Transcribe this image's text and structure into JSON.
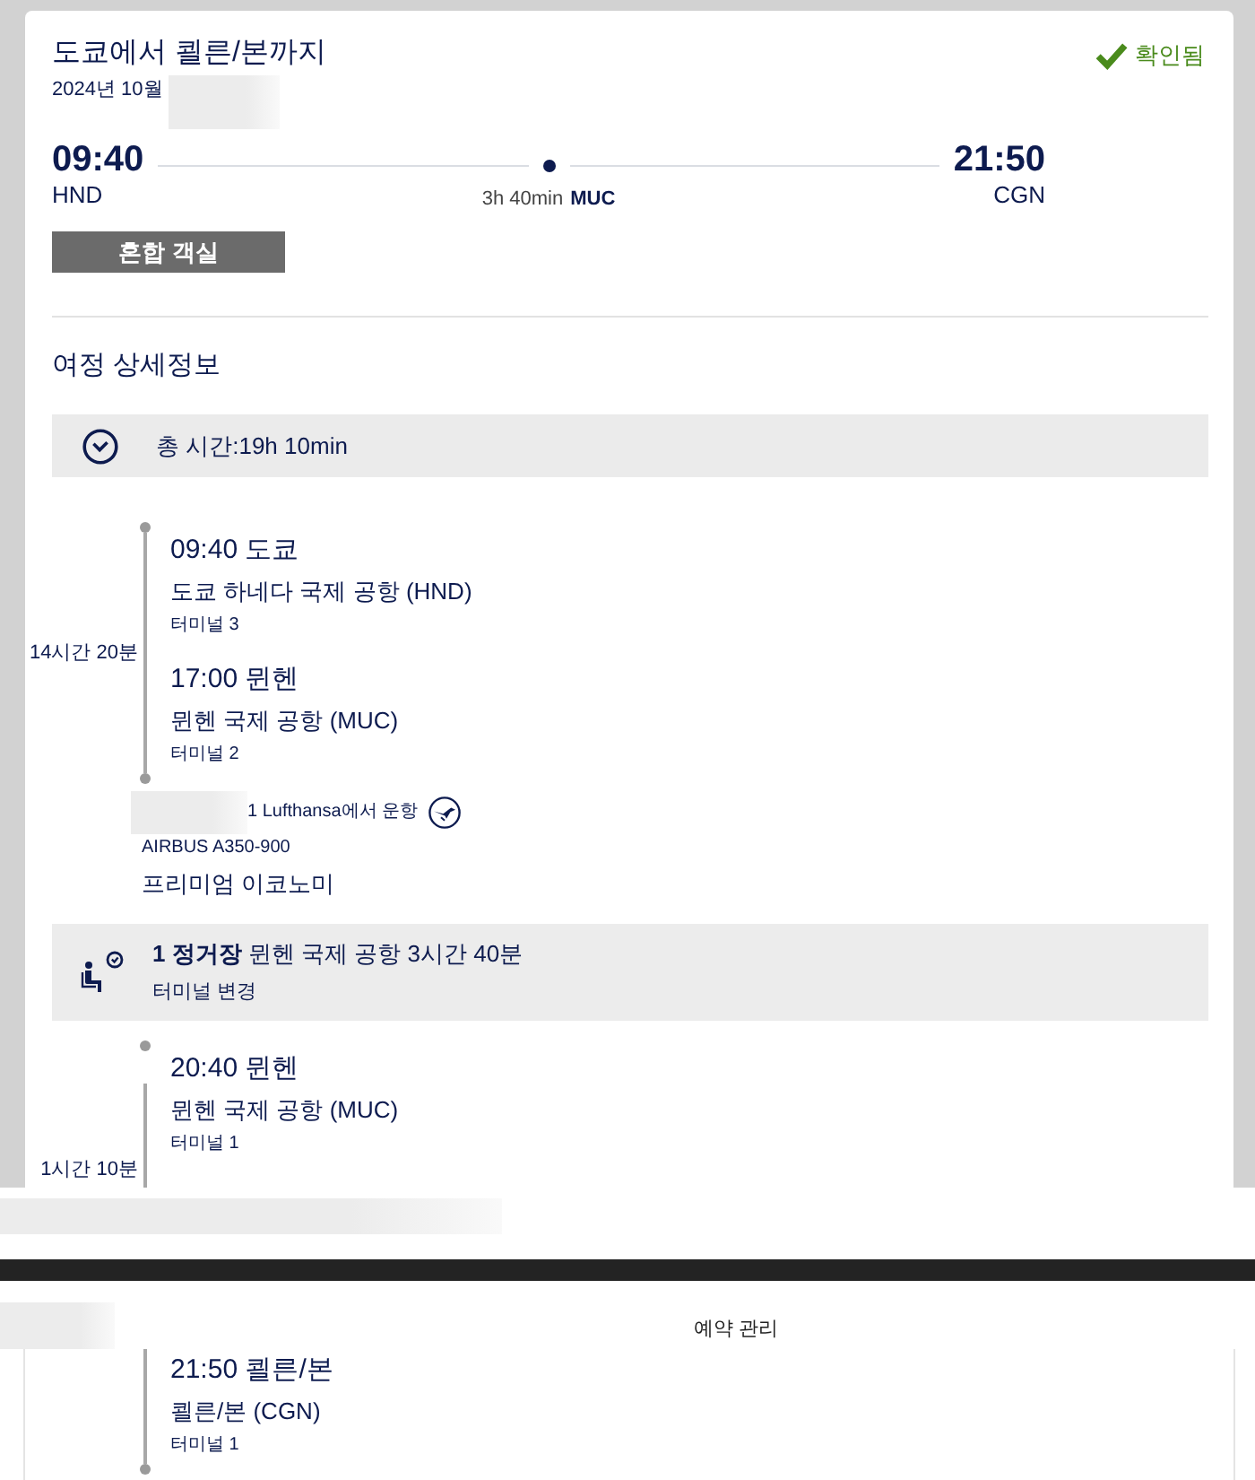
{
  "itinerary": {
    "title": "도쿄에서 쾰른/본까지",
    "date": "2024년 10월",
    "status": "확인됨",
    "route": {
      "departure": {
        "time": "09:40",
        "airport": "HND"
      },
      "stopover": {
        "duration": "3h 40min",
        "airport": "MUC"
      },
      "arrival": {
        "time": "21:50",
        "airport": "CGN"
      }
    },
    "cabin_tag": "혼합 객실"
  },
  "details": {
    "title": "여정 상세정보",
    "total_time": "총 시간:19h 10min",
    "legs": [
      {
        "kind": "flight",
        "duration": "14시간 20분",
        "stops": [
          {
            "heading": "09:40 도쿄",
            "airport": "도쿄 하네다 국제 공항 (HND)",
            "terminal": "터미널 3"
          },
          {
            "heading": "17:00 뮌헨",
            "airport": "뮌헨 국제 공항 (MUC)",
            "terminal": "터미널 2"
          }
        ],
        "operator": "1 Lufthansa에서 운항",
        "aircraft": "AIRBUS A350-900",
        "cabin": "프리미엄 이코노미"
      },
      {
        "kind": "layover",
        "summary": "**1 정거장** 뮌헨 국제 공항 3시간 40분",
        "note": "터미널 변경"
      },
      {
        "kind": "flight",
        "duration": "1시간 10분",
        "stops": [
          {
            "heading": "20:40 뮌헨",
            "airport": "뮌헨 국제 공항 (MUC)",
            "terminal": "터미널 1"
          }
        ]
      }
    ]
  },
  "booking_bar": {
    "title": "예약 관리"
  },
  "continued_leg": {
    "stops": [
      {
        "heading": "21:50 쾰른/본",
        "airport": "쾰른/본 (CGN)",
        "terminal": "터미널 1"
      }
    ]
  }
}
